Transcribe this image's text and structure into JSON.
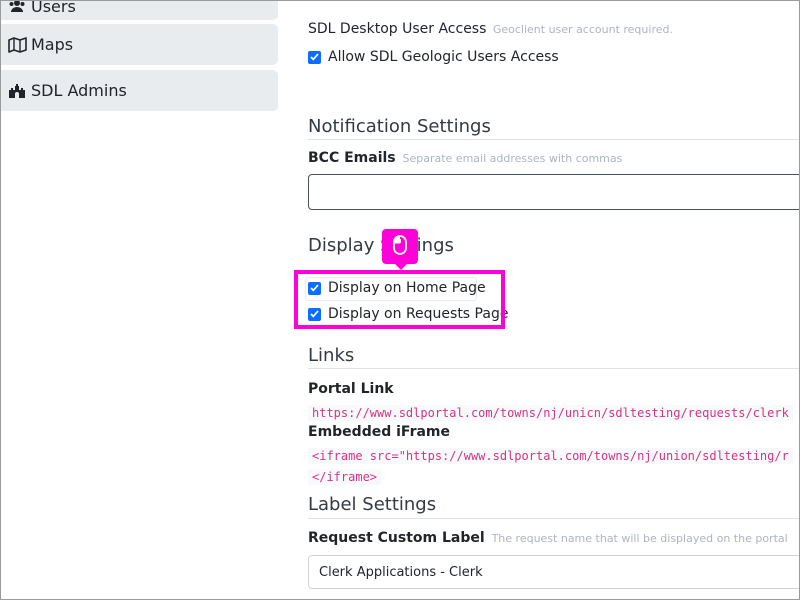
{
  "sidebar": {
    "items": [
      {
        "label": "Users",
        "icon": "users-icon"
      },
      {
        "label": "Maps",
        "icon": "map-icon"
      },
      {
        "label": "SDL Admins",
        "icon": "castle-icon"
      }
    ]
  },
  "access": {
    "desktop_label": "SDL Desktop User Access",
    "desktop_hint": "Geoclient user account required.",
    "allow_geologic_label": "Allow SDL Geologic Users Access"
  },
  "notification": {
    "title": "Notification Settings",
    "bcc_label": "BCC Emails",
    "bcc_hint": "Separate email addresses with commas",
    "bcc_value": ""
  },
  "display": {
    "title": "Display Settings",
    "home_label": "Display on Home Page",
    "requests_label": "Display on Requests Page"
  },
  "links": {
    "title": "Links",
    "portal_label": "Portal Link",
    "portal_url": "https://www.sdlportal.com/towns/nj/unicn/sdltesting/requests/clerk",
    "iframe_label": "Embedded iFrame",
    "iframe_code_line1": "<iframe src=\"https://www.sdlportal.com/towns/nj/union/sdltesting/r",
    "iframe_code_line2": "</iframe>"
  },
  "label_settings": {
    "title": "Label Settings",
    "custom_label": "Request Custom Label",
    "custom_hint": "The request name that will be displayed on the portal",
    "custom_value": "Clerk Applications - Clerk"
  },
  "colors": {
    "highlight": "#ff00d9",
    "checkbox": "#0d6efd",
    "code": "#d63384"
  }
}
